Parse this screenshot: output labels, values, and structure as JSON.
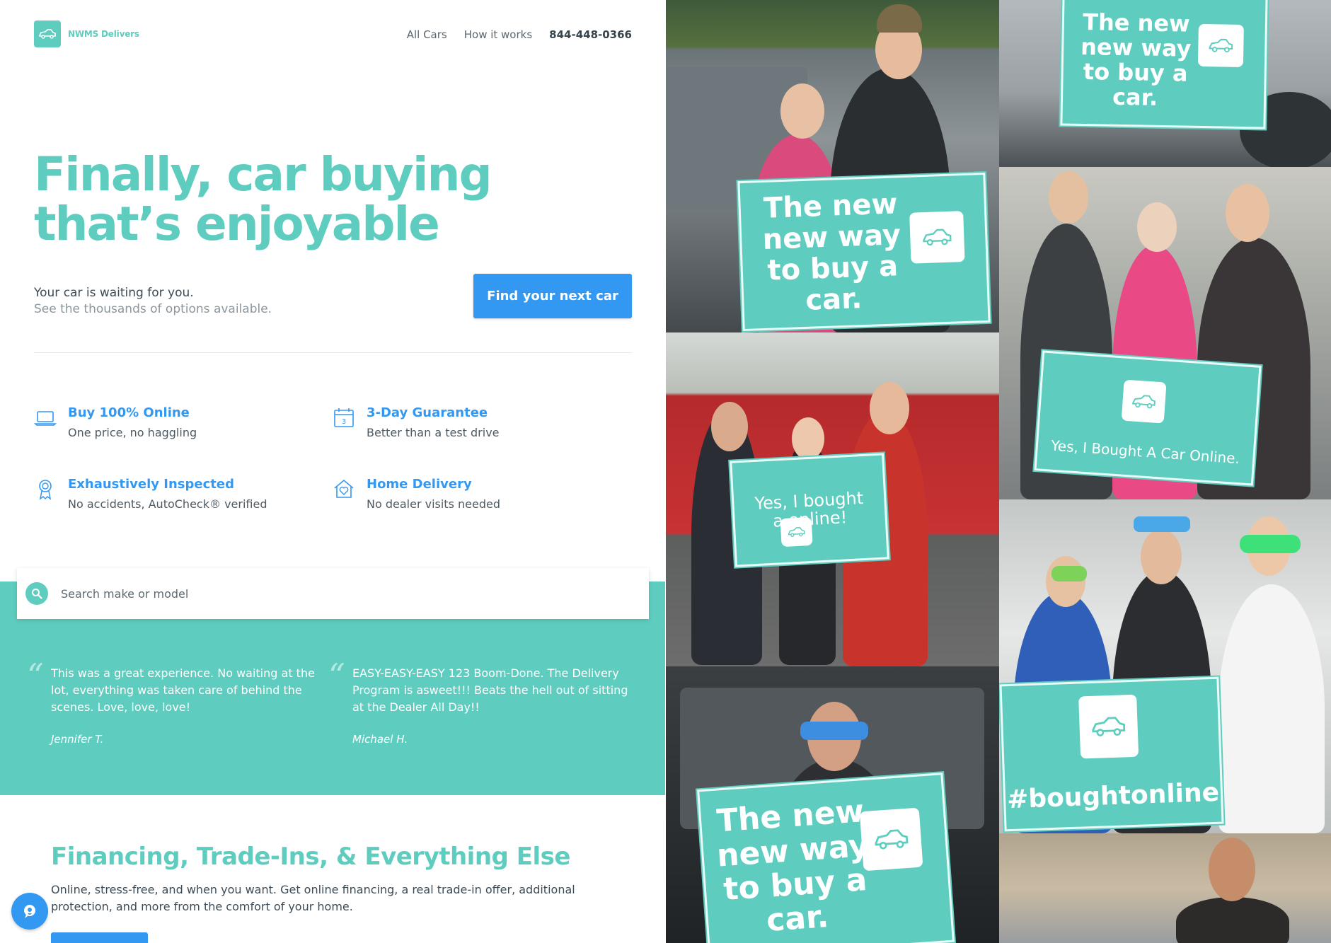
{
  "brand": {
    "name": "NWMS Delivers",
    "accent": "#5ecdbf",
    "blue": "#3398f2"
  },
  "nav": {
    "all_cars": "All Cars",
    "how_it_works": "How it works",
    "phone": "844-448-0366"
  },
  "hero": {
    "title": "Finally, car buying that’s enjoyable",
    "subtitle_line1": "Your car is waiting for you.",
    "subtitle_line2": "See the thousands of options available.",
    "cta": "Find your next car"
  },
  "features": [
    {
      "icon": "laptop-icon",
      "title": "Buy 100% Online",
      "desc": "One price, no haggling"
    },
    {
      "icon": "calendar-icon",
      "title": "3-Day Guarantee",
      "desc": "Better than a test drive"
    },
    {
      "icon": "ribbon-icon",
      "title": "Exhaustively Inspected",
      "desc": "No accidents, AutoCheck® verified"
    },
    {
      "icon": "home-heart-icon",
      "title": "Home Delivery",
      "desc": "No dealer visits needed"
    }
  ],
  "search": {
    "placeholder": "Search make or model"
  },
  "testimonials": [
    {
      "text": "This was a great experience. No waiting at the lot, everything was taken care of behind the scenes. Love, love, love!",
      "author": "Jennifer T."
    },
    {
      "text": "EASY-EASY-EASY 123 Boom-Done. The Delivery Program is asweet!!! Beats the hell out of sitting at the Dealer All Day!!",
      "author": "Michael H."
    }
  ],
  "financing": {
    "title": "Financing, Trade-Ins, & Everything Else",
    "text": "Online, stress-free, and when you want. Get online financing, a real trade-in offer, additional protection, and more from the comfort of your home."
  },
  "photos": {
    "sign_new_way": "The new\nnew way\nto buy a car.",
    "sign_yes_bought": "Yes, I Bought A Car Online.",
    "sign_yes_bought_a": "Yes, I bought\na  online!",
    "sign_hashtag": "#boughtonline"
  }
}
